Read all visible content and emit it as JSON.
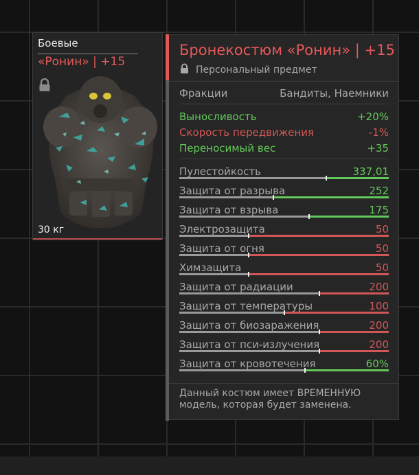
{
  "item_card": {
    "category": "Боевые",
    "name": "«Ронин» | +15",
    "weight": "30 кг"
  },
  "tooltip": {
    "title": "Бронекостюм «Ронин» | +15",
    "subtitle": "Персональный предмет",
    "factions_label": "Фракции",
    "factions_value": "Бандиты, Наемники",
    "bonuses": [
      {
        "label": "Выносливость",
        "value": "+20%",
        "tone": "green"
      },
      {
        "label": "Скорость передвижения",
        "value": "-1%",
        "tone": "red"
      },
      {
        "label": "Переносимый вес",
        "value": "+35",
        "tone": "green"
      }
    ],
    "stats": [
      {
        "label": "Пулестойкость",
        "value": "337,01",
        "tone": "green",
        "base": 0.7,
        "delta": 0.3
      },
      {
        "label": "Защита от разрыва",
        "value": "252",
        "tone": "green",
        "base": 0.45,
        "delta": 0.55
      },
      {
        "label": "Защита от взрыва",
        "value": "175",
        "tone": "green",
        "base": 0.62,
        "delta": 0.38
      },
      {
        "label": "Электрозащита",
        "value": "50",
        "tone": "red",
        "base": 0.33,
        "delta": 0.67
      },
      {
        "label": "Защита от огня",
        "value": "50",
        "tone": "red",
        "base": 0.33,
        "delta": 0.67
      },
      {
        "label": "Химзащита",
        "value": "50",
        "tone": "red",
        "base": 0.33,
        "delta": 0.67
      },
      {
        "label": "Защита от радиации",
        "value": "200",
        "tone": "red",
        "base": 0.67,
        "delta": 0.33
      },
      {
        "label": "Защита от температуры",
        "value": "100",
        "tone": "red",
        "base": 0.5,
        "delta": 0.5
      },
      {
        "label": "Защита от биозаражения",
        "value": "200",
        "tone": "red",
        "base": 0.67,
        "delta": 0.33
      },
      {
        "label": "Защита от пси-излучения",
        "value": "200",
        "tone": "red",
        "base": 0.67,
        "delta": 0.33
      },
      {
        "label": "Защита от кровотечения",
        "value": "60%",
        "tone": "green",
        "base": 0.6,
        "delta": 0.4
      }
    ],
    "description": "Данный костюм имеет ВРЕМЕННУЮ модель, которая будет заменена."
  },
  "colors": {
    "accent_red": "#e2575a",
    "stat_green": "#62c95a",
    "stat_red": "#d25757"
  },
  "icons": {
    "lock": "lock-icon"
  }
}
